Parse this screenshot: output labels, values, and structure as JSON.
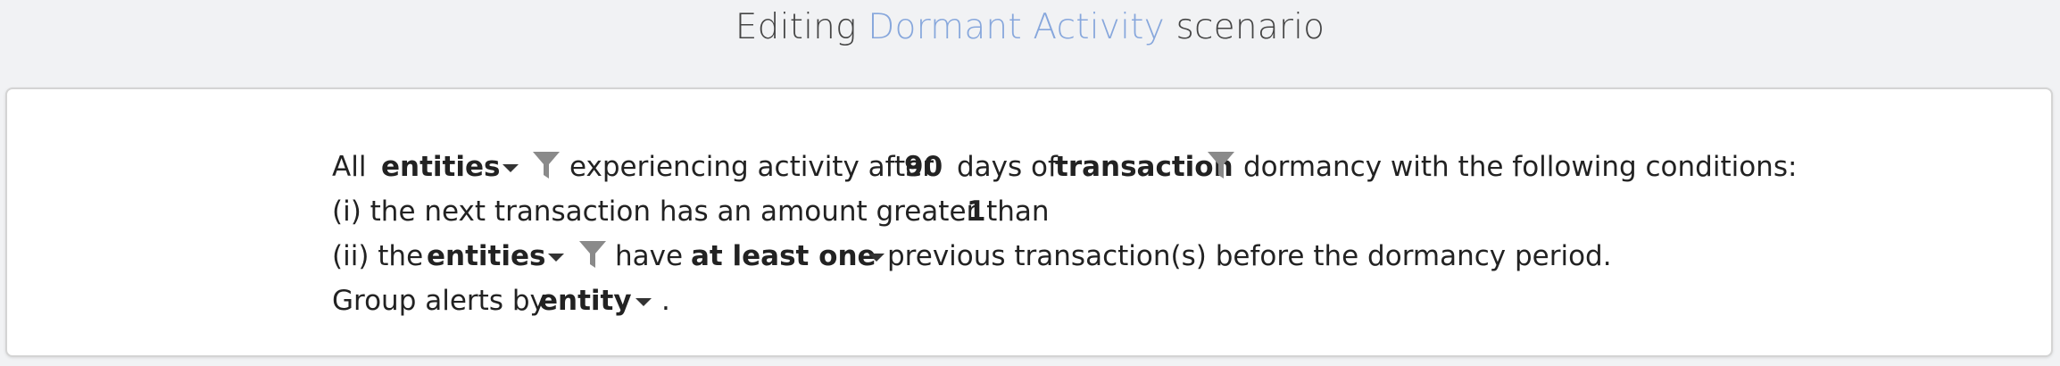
{
  "title": {
    "prefix": "Editing",
    "scenario_name": "Dormant Activity",
    "suffix": "scenario"
  },
  "colors": {
    "accent": "#87a7dc",
    "filter_icon": "#8a8a8a",
    "panel_border": "#d4d4d4"
  },
  "statement": {
    "line1": {
      "all": "All",
      "entity_select": "entities",
      "experiencing": "experiencing activity after",
      "days_value": "90",
      "days_of": "days of",
      "transaction": "transaction",
      "dormancy": "dormancy with the following conditions:"
    },
    "line2": {
      "text": "(i) the next transaction has an amount greater than",
      "amount_value": "1"
    },
    "line3": {
      "prefix": "(ii) the",
      "entity_select": "entities",
      "have": "have",
      "quantifier_select": "at least one",
      "suffix": "previous transaction(s) before the dormancy period."
    },
    "line4": {
      "group_by": "Group alerts by",
      "group_select": "entity",
      "period": "."
    }
  },
  "icons": {
    "filter": "filter-icon",
    "caret": "chevron-down-icon"
  }
}
